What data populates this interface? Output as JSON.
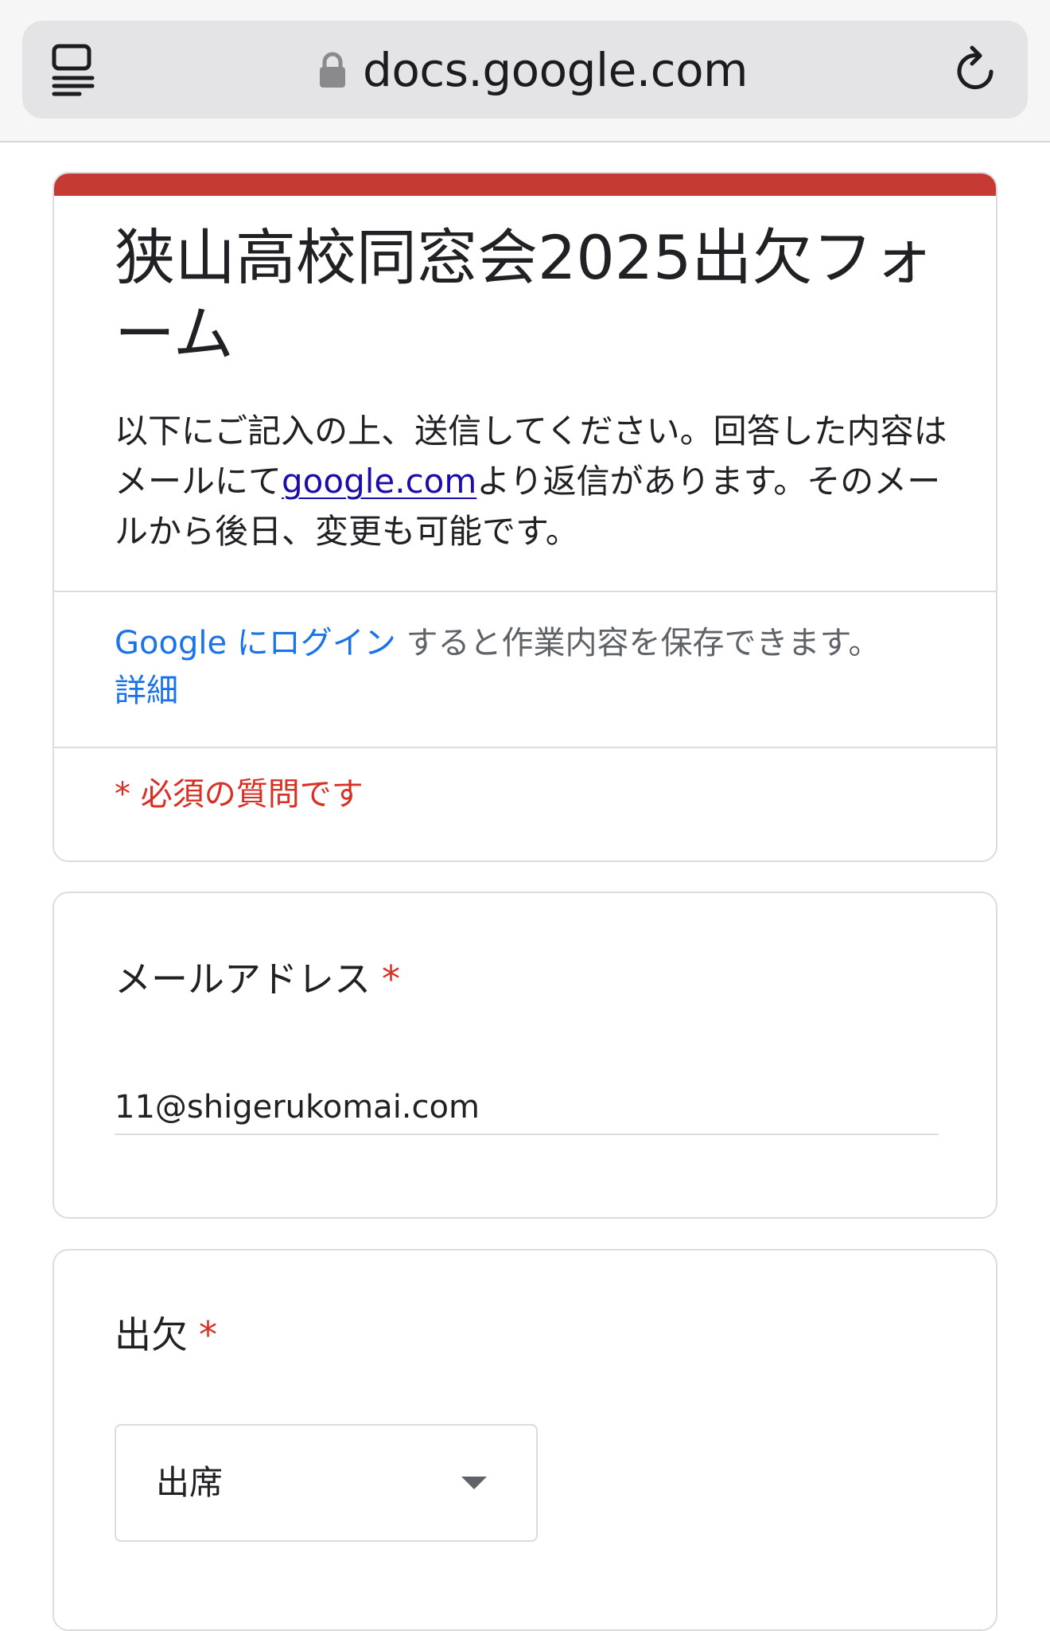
{
  "browser": {
    "url": "docs.google.com",
    "icons": {
      "reader": "reader-mode-icon",
      "lock": "lock-icon",
      "reload": "reload-icon"
    }
  },
  "form": {
    "accent_color": "#c53a33",
    "title": "狭山高校同窓会2025出欠フォーム",
    "description_before_link": "以下にご記入の上、送信してください。回答した内容はメールにて",
    "description_link": "google.com",
    "description_after_link": "より返信があります。そのメールから後日、変更も可能です。",
    "login_link": "Google にログイン",
    "login_text": "すると作業内容を保存できます。",
    "details_link": "詳細",
    "required_note": "* 必須の質問です"
  },
  "questions": {
    "email": {
      "label": "メールアドレス",
      "required_marker": "*",
      "value": "11@shigerukomai.com"
    },
    "attendance": {
      "label": "出欠",
      "required_marker": "*",
      "selected": "出席"
    }
  },
  "colors": {
    "required": "#d93025",
    "link": "#1a73e8",
    "border": "#dadce0"
  }
}
